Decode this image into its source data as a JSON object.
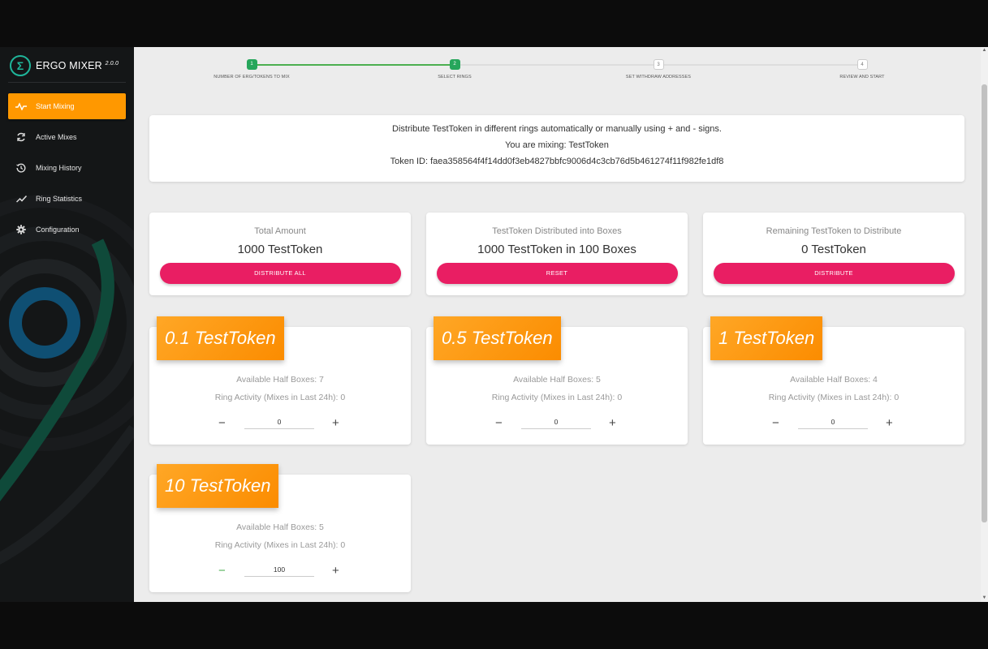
{
  "sidebar": {
    "brand_name": "ERGO MIXER",
    "brand_version": "2.0.0",
    "logo_glyph": "Σ",
    "items": [
      {
        "label": "Start Mixing",
        "icon": "start-mixing-icon"
      },
      {
        "label": "Active Mixes",
        "icon": "refresh-icon"
      },
      {
        "label": "Mixing History",
        "icon": "history-icon"
      },
      {
        "label": "Ring Statistics",
        "icon": "trending-icon"
      },
      {
        "label": "Configuration",
        "icon": "gear-icon"
      }
    ]
  },
  "stepper": {
    "steps": [
      {
        "number": "1",
        "label": "NUMBER OF ERG/TOKENS TO MIX",
        "state": "done"
      },
      {
        "number": "2",
        "label": "SELECT RINGS",
        "state": "done"
      },
      {
        "number": "3",
        "label": "SET WITHDRAW ADDRESSES",
        "state": "todo"
      },
      {
        "number": "4",
        "label": "REVIEW AND START",
        "state": "todo"
      }
    ]
  },
  "info": {
    "line1": "Distribute TestToken in different rings automatically or manually using + and - signs.",
    "line2": "You are mixing: TestToken",
    "line3": "Token ID: faea358564f4f14dd0f3eb4827bbfc9006d4c3cb76d5b461274f11f982fe1df8"
  },
  "stats": [
    {
      "title": "Total Amount",
      "value": "1000 TestToken",
      "button": "DISTRIBUTE ALL"
    },
    {
      "title": "TestToken Distributed into Boxes",
      "value": "1000 TestToken in 100 Boxes",
      "button": "RESET"
    },
    {
      "title": "Remaining TestToken to Distribute",
      "value": "0 TestToken",
      "button": "DISTRIBUTE"
    }
  ],
  "rings": [
    {
      "label": "0.1 TestToken",
      "available": "Available Half Boxes: 7",
      "activity": "Ring Activity (Mixes in Last 24h): 0",
      "qty": "0"
    },
    {
      "label": "0.5 TestToken",
      "available": "Available Half Boxes: 5",
      "activity": "Ring Activity (Mixes in Last 24h): 0",
      "qty": "0"
    },
    {
      "label": "1 TestToken",
      "available": "Available Half Boxes: 4",
      "activity": "Ring Activity (Mixes in Last 24h): 0",
      "qty": "0"
    },
    {
      "label": "10 TestToken",
      "available": "Available Half Boxes: 5",
      "activity": "Ring Activity (Mixes in Last 24h): 0",
      "qty": "100"
    }
  ],
  "controls": {
    "minus": "−",
    "plus": "+"
  },
  "colors": {
    "accent": "#ff9800",
    "button": "#e91e63",
    "step_done": "#26a65b",
    "sidebar": "#141617"
  }
}
